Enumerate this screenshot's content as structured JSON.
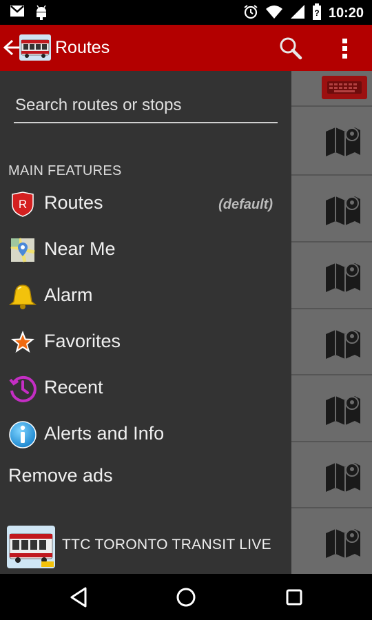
{
  "status_bar": {
    "time": "10:20",
    "icons": [
      "gmail-icon",
      "android-icon",
      "alarm-icon",
      "wifi-icon",
      "signal-icon",
      "battery-icon"
    ]
  },
  "app_bar": {
    "title": "Routes",
    "brand_color": "#b30000",
    "icons": [
      "back-arrow-icon",
      "bus-logo-icon",
      "search-icon",
      "overflow-menu-icon"
    ]
  },
  "drawer": {
    "search": {
      "placeholder": "Search routes or stops",
      "value": ""
    },
    "section_title": "MAIN FEATURES",
    "items": [
      {
        "label": "Routes",
        "badge": "(default)",
        "icon": "routes-shield-icon"
      },
      {
        "label": "Near Me",
        "icon": "map-location-icon"
      },
      {
        "label": "Alarm",
        "icon": "bell-icon"
      },
      {
        "label": "Favorites",
        "icon": "star-icon"
      },
      {
        "label": "Recent",
        "icon": "history-clock-icon"
      },
      {
        "label": "Alerts and Info",
        "icon": "info-icon"
      }
    ],
    "remove_ads": "Remove ads",
    "footer_app": {
      "label": "TTC TORONTO TRANSIT LIVE",
      "icon": "streetcar-logo-icon"
    }
  },
  "background_list": {
    "row_icon": "map-pin-icon",
    "keyboard_icon": "keyboard-icon"
  },
  "nav_bar": {
    "icons": [
      "back-triangle-icon",
      "home-circle-icon",
      "recents-square-icon"
    ]
  }
}
